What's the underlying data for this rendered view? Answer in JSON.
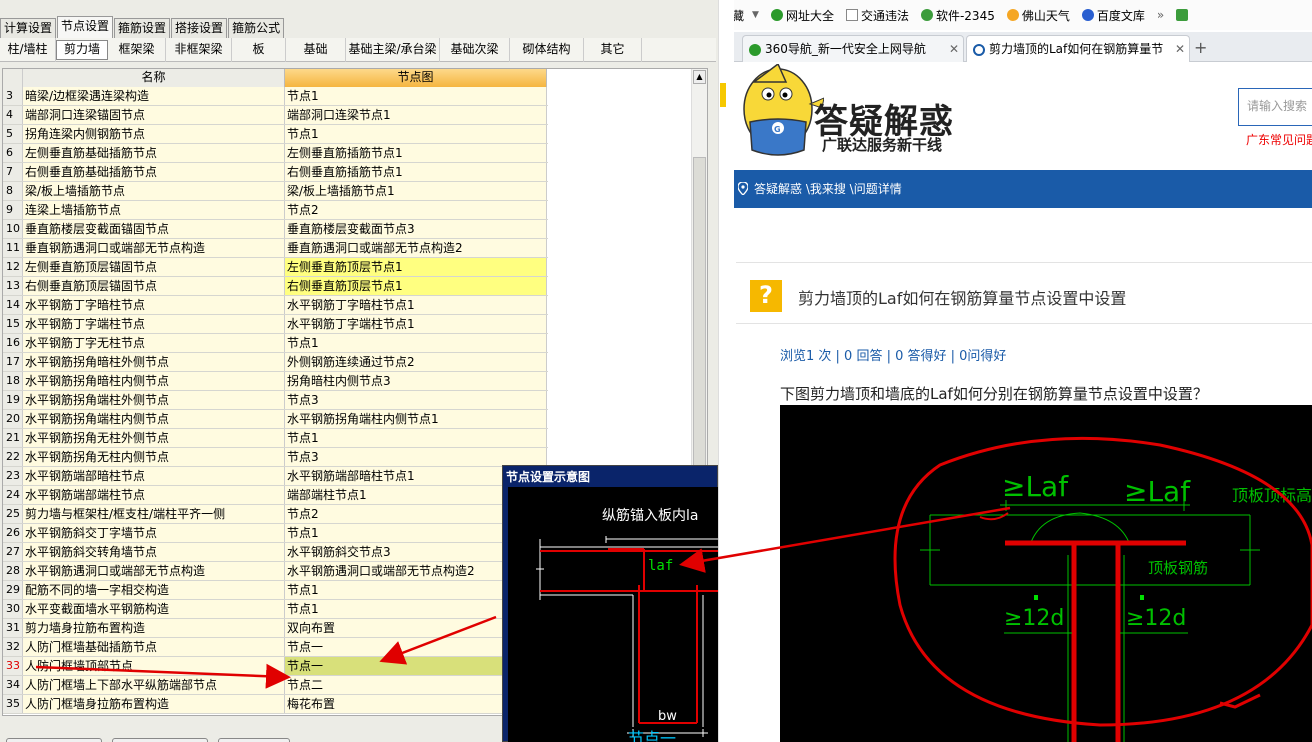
{
  "left": {
    "main_tabs": [
      "计算设置",
      "节点设置",
      "箍筋设置",
      "搭接设置",
      "箍筋公式"
    ],
    "sub_tabs": [
      "柱/墙柱",
      "剪力墙",
      "框架梁",
      "非框架梁",
      "板",
      "基础",
      "基础主梁/承台梁",
      "基础次梁",
      "砌体结构",
      "其它"
    ],
    "grid": {
      "col_name": "名称",
      "col_node": "节点图",
      "rows": [
        {
          "num": "3",
          "name": "暗梁/边框梁遇连梁构造",
          "node": "节点1"
        },
        {
          "num": "4",
          "name": "端部洞口连梁锚固节点",
          "node": "端部洞口连梁节点1"
        },
        {
          "num": "5",
          "name": "拐角连梁内侧钢筋节点",
          "node": "节点1"
        },
        {
          "num": "6",
          "name": "左侧垂直筋基础插筋节点",
          "node": "左侧垂直筋插筋节点1"
        },
        {
          "num": "7",
          "name": "右侧垂直筋基础插筋节点",
          "node": "右侧垂直筋插筋节点1"
        },
        {
          "num": "8",
          "name": "梁/板上墙插筋节点",
          "node": "梁/板上墙插筋节点1"
        },
        {
          "num": "9",
          "name": "连梁上墙插筋节点",
          "node": "节点2"
        },
        {
          "num": "10",
          "name": "垂直筋楼层变截面锚固节点",
          "node": "垂直筋楼层变截面节点3"
        },
        {
          "num": "11",
          "name": "垂直钢筋遇洞口或端部无节点构造",
          "node": "垂直筋遇洞口或端部无节点构造2"
        },
        {
          "num": "12",
          "name": "左侧垂直筋顶层锚固节点",
          "node": "左侧垂直筋顶层节点1"
        },
        {
          "num": "13",
          "name": "右侧垂直筋顶层锚固节点",
          "node": "右侧垂直筋顶层节点1"
        },
        {
          "num": "14",
          "name": "水平钢筋丁字暗柱节点",
          "node": "水平钢筋丁字暗柱节点1"
        },
        {
          "num": "15",
          "name": "水平钢筋丁字端柱节点",
          "node": "水平钢筋丁字端柱节点1"
        },
        {
          "num": "16",
          "name": "水平钢筋丁字无柱节点",
          "node": "节点1"
        },
        {
          "num": "17",
          "name": "水平钢筋拐角暗柱外侧节点",
          "node": "外侧钢筋连续通过节点2"
        },
        {
          "num": "18",
          "name": "水平钢筋拐角暗柱内侧节点",
          "node": "拐角暗柱内侧节点3"
        },
        {
          "num": "19",
          "name": "水平钢筋拐角端柱外侧节点",
          "node": "节点3"
        },
        {
          "num": "20",
          "name": "水平钢筋拐角端柱内侧节点",
          "node": "水平钢筋拐角端柱内侧节点1"
        },
        {
          "num": "21",
          "name": "水平钢筋拐角无柱外侧节点",
          "node": "节点1"
        },
        {
          "num": "22",
          "name": "水平钢筋拐角无柱内侧节点",
          "node": "节点3"
        },
        {
          "num": "23",
          "name": "水平钢筋端部暗柱节点",
          "node": "水平钢筋端部暗柱节点1"
        },
        {
          "num": "24",
          "name": "水平钢筋端部端柱节点",
          "node": "端部端柱节点1"
        },
        {
          "num": "25",
          "name": "剪力墙与框架柱/框支柱/端柱平齐一侧",
          "node": "节点2"
        },
        {
          "num": "26",
          "name": "水平钢筋斜交丁字墙节点",
          "node": "节点1"
        },
        {
          "num": "27",
          "name": "水平钢筋斜交转角墙节点",
          "node": "水平钢筋斜交节点3"
        },
        {
          "num": "28",
          "name": "水平钢筋遇洞口或端部无节点构造",
          "node": "水平钢筋遇洞口或端部无节点构造2"
        },
        {
          "num": "29",
          "name": "配筋不同的墙一字相交构造",
          "node": "节点1"
        },
        {
          "num": "30",
          "name": "水平变截面墙水平钢筋构造",
          "node": "节点1"
        },
        {
          "num": "31",
          "name": "剪力墙身拉筋布置构造",
          "node": "双向布置"
        },
        {
          "num": "32",
          "name": "人防门框墙基础插筋节点",
          "node": "节点一"
        },
        {
          "num": "33",
          "name": "人防门框墙顶部节点",
          "node": "节点一"
        },
        {
          "num": "34",
          "name": "人防门框墙上下部水平纵筋端部节点",
          "node": "节点二"
        },
        {
          "num": "35",
          "name": "人防门框墙身拉筋布置构造",
          "node": "梅花布置"
        }
      ]
    },
    "popup": {
      "title": "节点设置示意图",
      "text_top": "纵筋锚入板内la",
      "laf": "laf",
      "bw": "bw",
      "caption": "节点一"
    }
  },
  "browser": {
    "bookmarks": [
      "收藏",
      "网址大全",
      "交通违法",
      "软件-2345",
      "佛山天气",
      "百度文库"
    ],
    "tabs": [
      {
        "title": "360导航_新一代安全上网导航"
      },
      {
        "title": "剪力墙顶的Laf如何在钢筋算量节"
      }
    ],
    "new_tab": "+",
    "site": {
      "title": "答疑解惑",
      "subtitle": "广联达服务新干线",
      "search_placeholder": "请输入搜索",
      "hot_link": "广东常见问题",
      "breadcrumb": "答疑解惑 \\我来搜 \\问题详情"
    },
    "question": {
      "icon": "?",
      "title": "剪力墙顶的Laf如何在钢筋算量节点设置中设置",
      "stats": "浏览1 次 | 0 回答 | 0 答得好 | 0问得好",
      "body": "下图剪力墙顶和墙底的Laf如何分别在钢筋算量节点设置中设置？"
    },
    "cad": {
      "label_laf_1": "≥Laf",
      "label_laf_2": "≥Laf",
      "label_top": "顶板顶标高",
      "label_rebar": "顶板钢筋",
      "label_12d_1": "≥12d",
      "label_12d_2": "≥12d"
    }
  },
  "colors": {
    "accent_blue": "#1a5ba8",
    "highlight_yellow": "#ffff80",
    "selected": "#d8e07a",
    "annot_red": "#e00000"
  }
}
